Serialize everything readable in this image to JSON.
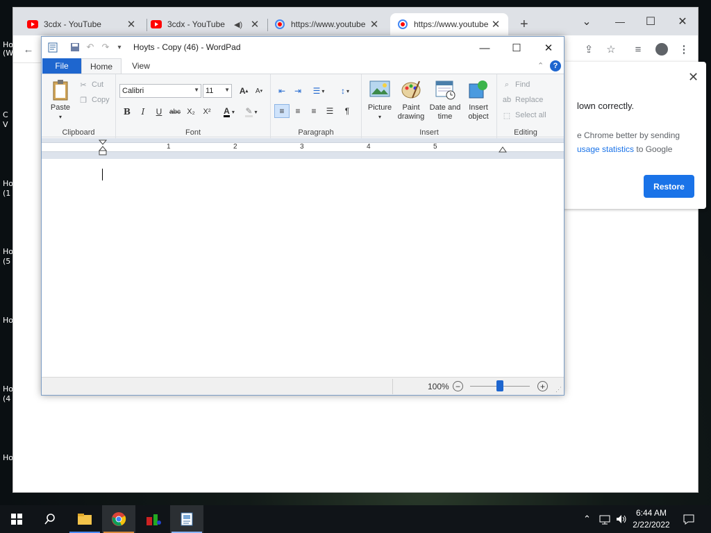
{
  "desktop": {
    "icon_labels": [
      "Ho",
      "(W",
      "Ho",
      "(1",
      "Ho",
      "(5",
      "Ho",
      "Ho",
      "(4",
      "Ho"
    ],
    "extra_labels": [
      "C",
      "V"
    ]
  },
  "chrome": {
    "tabs": [
      {
        "title": "3cdx - YouTube"
      },
      {
        "title": "3cdx - YouTube"
      },
      {
        "title": "https://www.youtube"
      },
      {
        "title": "https://www.youtube"
      }
    ],
    "new_tab": "+",
    "window_controls": {
      "minimize": "—",
      "maximize": "☐",
      "close": "✕"
    },
    "restore_bubble": {
      "text_main": "lown correctly.",
      "text_body_prefix": "e Chrome better by sending",
      "text_link": "usage statistics",
      "text_suffix": " to Google",
      "button": "Restore",
      "close": "✕"
    }
  },
  "wordpad": {
    "title": "Hoyts - Copy (46) - WordPad",
    "window_controls": {
      "minimize": "—",
      "maximize": "☐",
      "close": "✕"
    },
    "tabs": {
      "file": "File",
      "home": "Home",
      "view": "View"
    },
    "help": "?",
    "clipboard": {
      "paste": "Paste",
      "cut": "Cut",
      "copy": "Copy",
      "label": "Clipboard"
    },
    "font": {
      "family": "Calibri",
      "size": "11",
      "label": "Font",
      "bold": "B",
      "italic": "I",
      "underline": "U",
      "strike": "abc",
      "subscript": "X₂",
      "superscript": "X²",
      "grow": "A",
      "shrink": "A",
      "font_color": "A",
      "highlight": "✎"
    },
    "paragraph": {
      "label": "Paragraph"
    },
    "insert": {
      "picture": "Picture",
      "paint_drawing_1": "Paint",
      "paint_drawing_2": "drawing",
      "date_time_1": "Date and",
      "date_time_2": "time",
      "insert_object_1": "Insert",
      "insert_object_2": "object",
      "label": "Insert"
    },
    "editing": {
      "find": "Find",
      "replace": "Replace",
      "select_all": "Select all",
      "label": "Editing"
    },
    "ruler_numbers": [
      "1",
      "2",
      "3",
      "4",
      "5"
    ],
    "zoom": "100%",
    "zoom_minus": "−",
    "zoom_plus": "+"
  },
  "taskbar": {
    "clock_time": "6:44 AM",
    "clock_date": "2/22/2022"
  },
  "colors": {
    "wordpad_file_tab": "#1e66cf",
    "chrome_accent": "#1a73e8",
    "youtube_red": "#ff0000"
  }
}
